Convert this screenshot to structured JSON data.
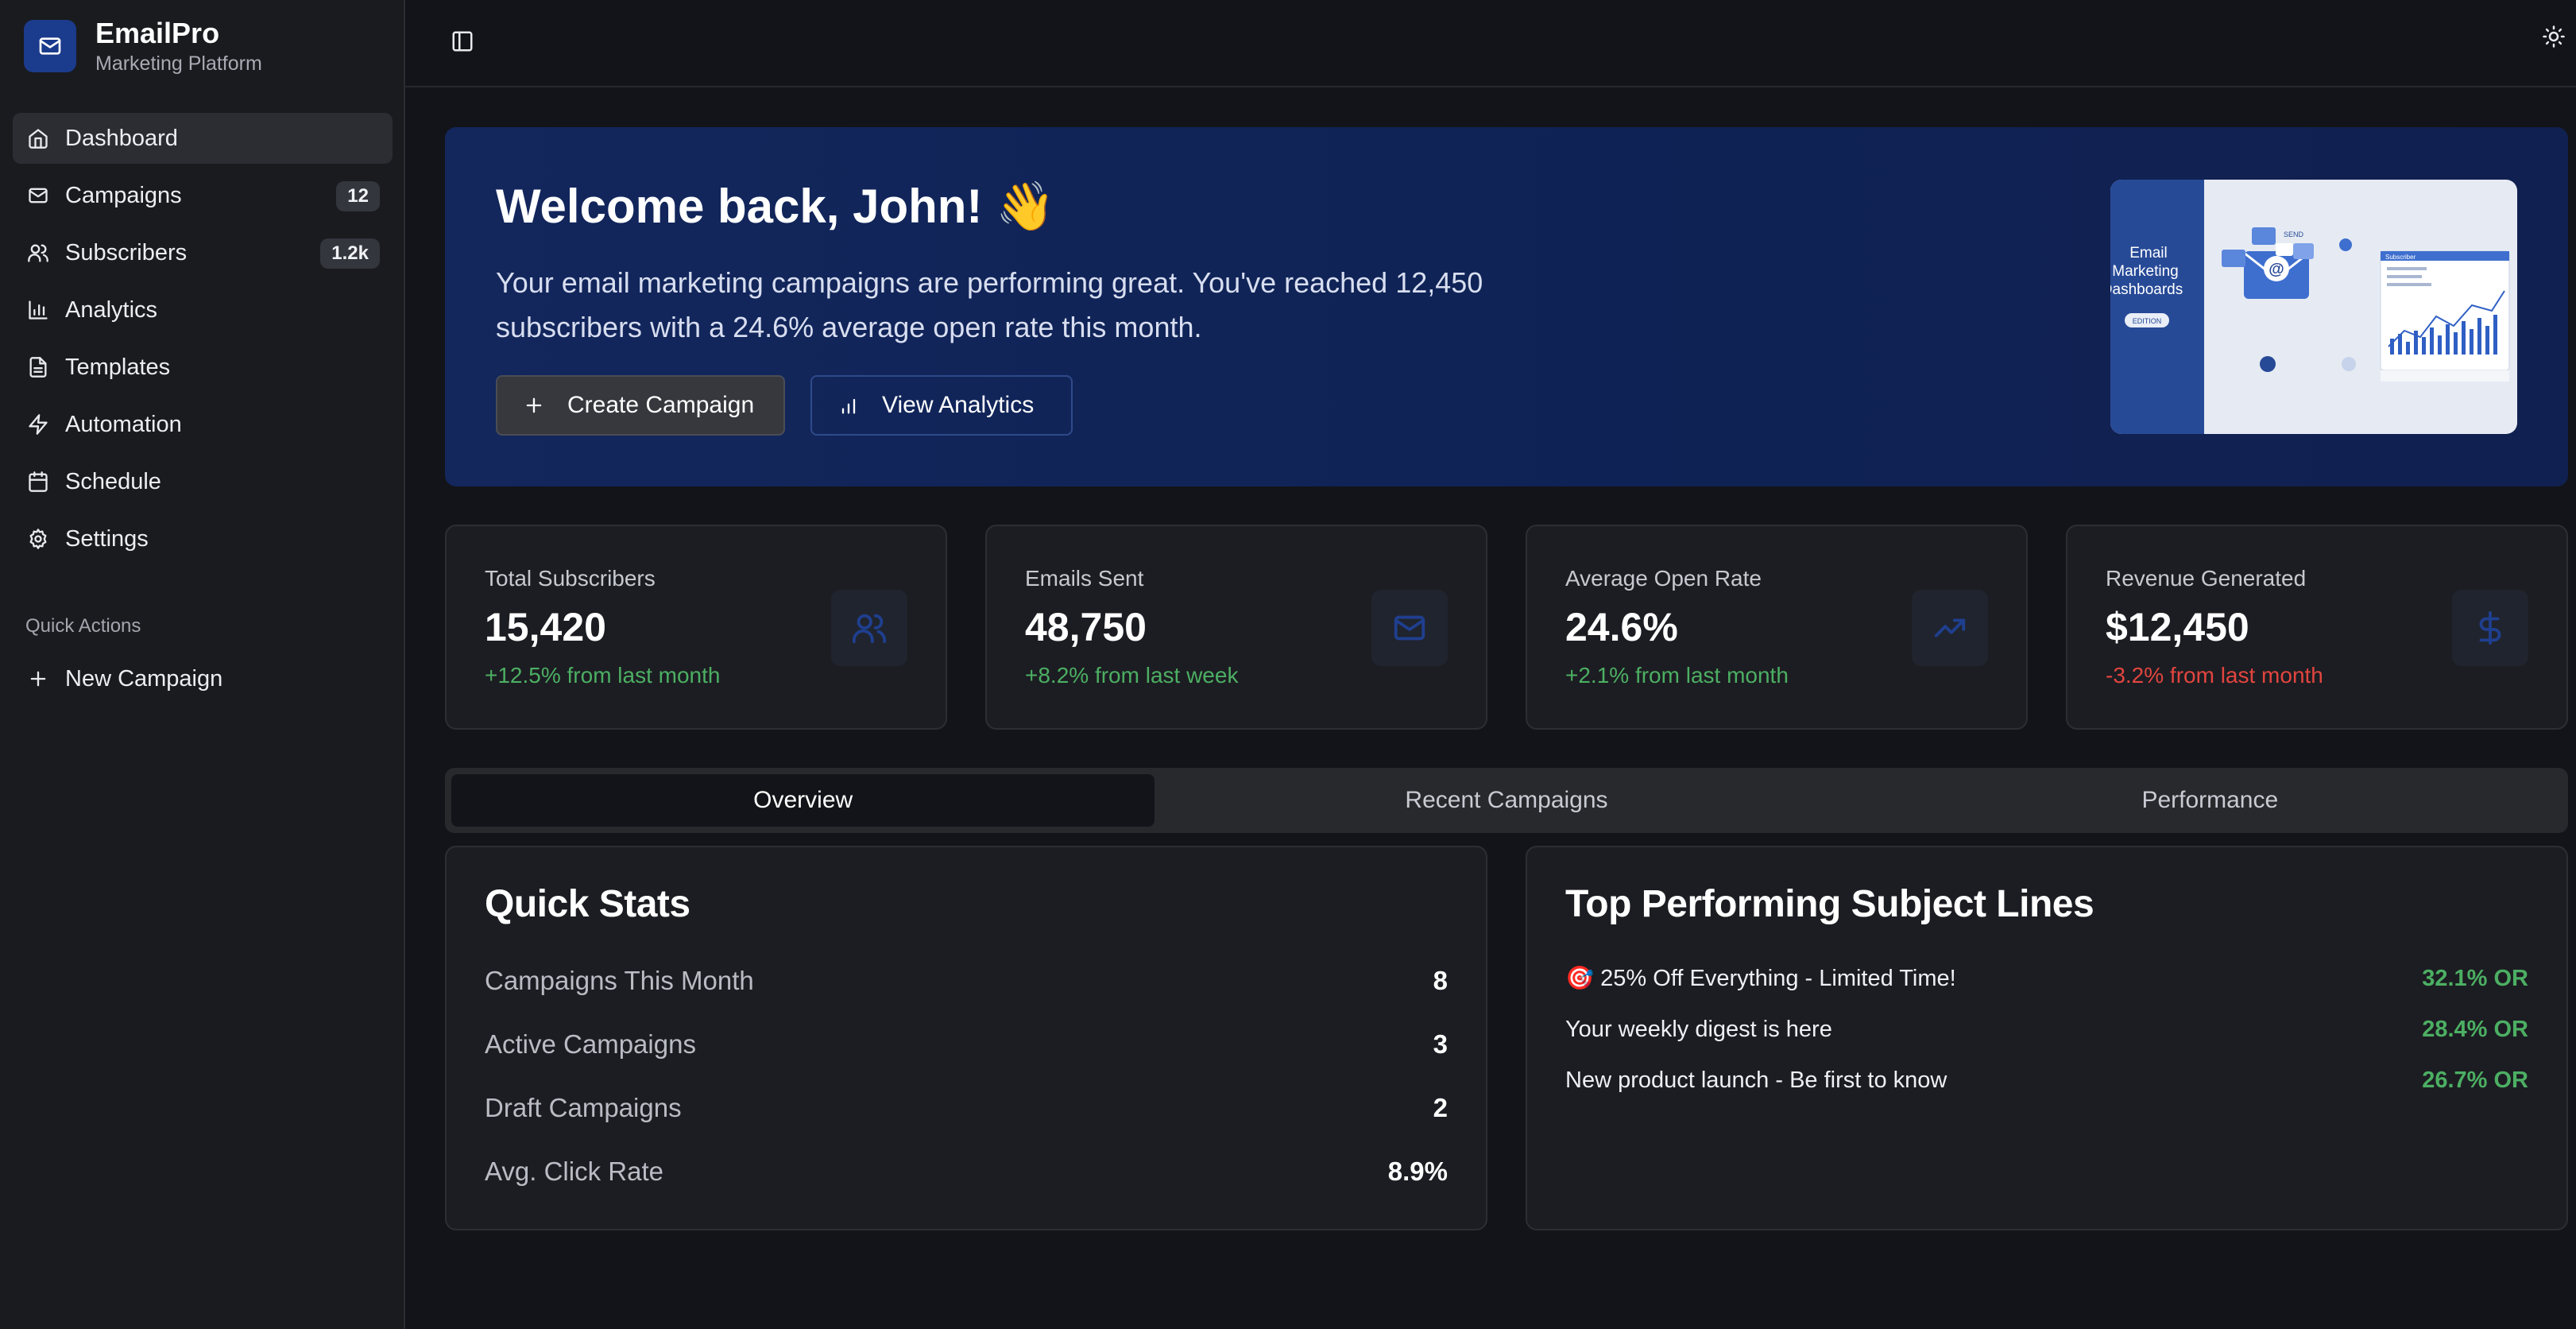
{
  "brand": {
    "name": "EmailPro",
    "subtitle": "Marketing Platform"
  },
  "sidebar": {
    "items": [
      {
        "label": "Dashboard",
        "icon": "home-icon",
        "active": true
      },
      {
        "label": "Campaigns",
        "icon": "mail-icon",
        "badge": "12"
      },
      {
        "label": "Subscribers",
        "icon": "users-icon",
        "badge": "1.2k"
      },
      {
        "label": "Analytics",
        "icon": "bar-chart-icon"
      },
      {
        "label": "Templates",
        "icon": "file-text-icon"
      },
      {
        "label": "Automation",
        "icon": "zap-icon"
      },
      {
        "label": "Schedule",
        "icon": "calendar-icon"
      },
      {
        "label": "Settings",
        "icon": "gear-icon"
      }
    ],
    "quick_actions_title": "Quick Actions",
    "quick_actions": [
      {
        "label": "New Campaign",
        "icon": "plus-icon"
      }
    ]
  },
  "hero": {
    "title": "Welcome back, John! 👋",
    "text": "Your email marketing campaigns are performing great. You've reached 12,450 subscribers with a 24.6% average open rate this month.",
    "create_label": "Create Campaign",
    "view_label": "View Analytics",
    "image_text": {
      "line1": "Email",
      "line2": "Marketing",
      "line3": "Dashboards",
      "tag": "EDITION",
      "send": "SEND",
      "panel": "Subscriber"
    }
  },
  "stats": [
    {
      "label": "Total Subscribers",
      "value": "15,420",
      "change": "+12.5% from last month",
      "trend": "positive",
      "icon": "users-icon"
    },
    {
      "label": "Emails Sent",
      "value": "48,750",
      "change": "+8.2% from last week",
      "trend": "positive",
      "icon": "mail-icon"
    },
    {
      "label": "Average Open Rate",
      "value": "24.6%",
      "change": "+2.1% from last month",
      "trend": "positive",
      "icon": "trending-up-icon"
    },
    {
      "label": "Revenue Generated",
      "value": "$12,450",
      "change": "-3.2% from last month",
      "trend": "negative",
      "icon": "dollar-icon"
    }
  ],
  "tabs": [
    {
      "label": "Overview",
      "active": true
    },
    {
      "label": "Recent Campaigns"
    },
    {
      "label": "Performance"
    }
  ],
  "quick_stats": {
    "title": "Quick Stats",
    "rows": [
      {
        "label": "Campaigns This Month",
        "value": "8"
      },
      {
        "label": "Active Campaigns",
        "value": "3"
      },
      {
        "label": "Draft Campaigns",
        "value": "2"
      },
      {
        "label": "Avg. Click Rate",
        "value": "8.9%"
      }
    ]
  },
  "subject_lines": {
    "title": "Top Performing Subject Lines",
    "rows": [
      {
        "text": "🎯 25% Off Everything - Limited Time!",
        "rate": "32.1% OR"
      },
      {
        "text": "Your weekly digest is here",
        "rate": "28.4% OR"
      },
      {
        "text": "New product launch - Be first to know",
        "rate": "26.7% OR"
      }
    ]
  },
  "colors": {
    "background": "#131419",
    "sidebar": "#1a1b1f",
    "hero": "#0f2356",
    "accent": "#1b3b8c",
    "positive": "#4caf63",
    "negative": "#e2453f"
  }
}
